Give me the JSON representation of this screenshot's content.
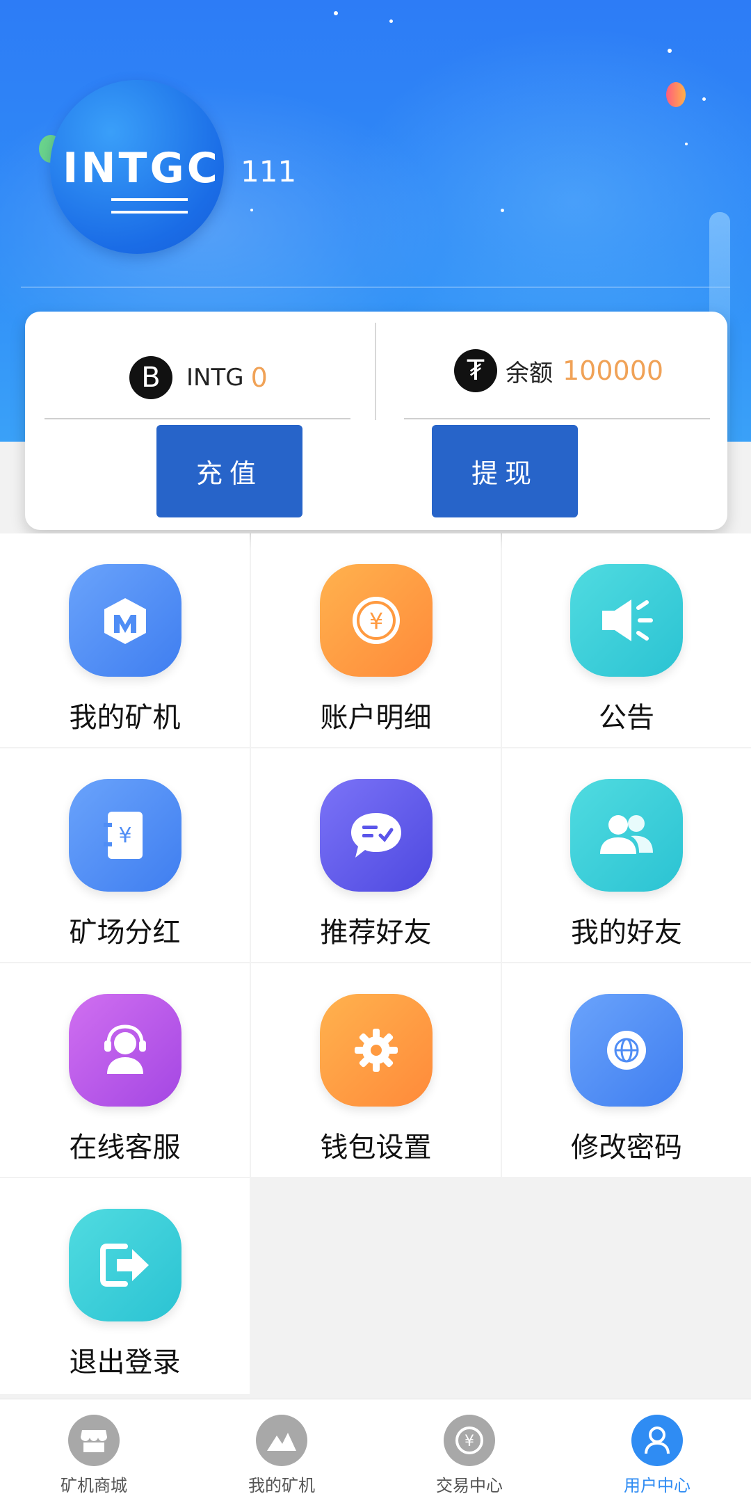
{
  "header": {
    "avatar_text": "INTGC",
    "username": "111"
  },
  "balance_card": {
    "left": {
      "coin_symbol": "B",
      "label": "INTG",
      "value": "0"
    },
    "right": {
      "coin_symbol": "₮",
      "label": "余额",
      "value": "100000"
    },
    "recharge_label": "充值",
    "withdraw_label": "提现",
    "colors": {
      "value": "#f0a257",
      "button": "#2764c9"
    }
  },
  "menu": {
    "items": [
      {
        "label": "我的矿机",
        "icon": "miner-icon"
      },
      {
        "label": "账户明细",
        "icon": "coin-icon"
      },
      {
        "label": "公告",
        "icon": "megaphone-icon"
      },
      {
        "label": "矿场分红",
        "icon": "ledger-icon"
      },
      {
        "label": "推荐好友",
        "icon": "chat-icon"
      },
      {
        "label": "我的好友",
        "icon": "friends-icon"
      },
      {
        "label": "在线客服",
        "icon": "support-icon"
      },
      {
        "label": "钱包设置",
        "icon": "gear-icon"
      },
      {
        "label": "修改密码",
        "icon": "globe-icon"
      },
      {
        "label": "退出登录",
        "icon": "logout-icon"
      }
    ]
  },
  "bottom_nav": {
    "items": [
      {
        "label": "矿机商城",
        "icon": "store-icon"
      },
      {
        "label": "我的矿机",
        "icon": "mountain-icon"
      },
      {
        "label": "交易中心",
        "icon": "exchange-icon"
      },
      {
        "label": "用户中心",
        "icon": "user-icon"
      }
    ],
    "active_index": 3,
    "active_color": "#2f8cf3"
  }
}
